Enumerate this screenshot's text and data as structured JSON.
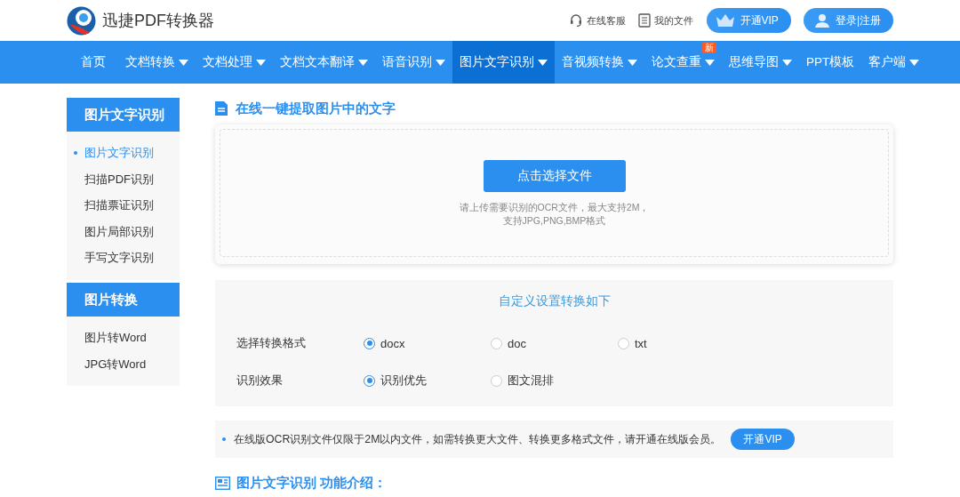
{
  "header": {
    "logo_text": "迅捷PDF转换器",
    "links": [
      {
        "kind": "service",
        "label": "在线客服"
      },
      {
        "kind": "files",
        "label": "我的文件"
      }
    ],
    "vip_button": "开通VIP",
    "login_button": "登录|注册"
  },
  "nav": [
    {
      "label": "首页",
      "dropdown": false,
      "selected": false
    },
    {
      "label": "文档转换",
      "dropdown": true,
      "selected": false
    },
    {
      "label": "文档处理",
      "dropdown": true,
      "selected": false
    },
    {
      "label": "文档文本翻译",
      "dropdown": true,
      "selected": false
    },
    {
      "label": "语音识别",
      "dropdown": true,
      "selected": false
    },
    {
      "label": "图片文字识别",
      "dropdown": true,
      "selected": true
    },
    {
      "label": "音视频转换",
      "dropdown": true,
      "selected": false
    },
    {
      "label": "论文查重",
      "dropdown": true,
      "selected": false,
      "badge": "新"
    },
    {
      "label": "思维导图",
      "dropdown": true,
      "selected": false
    },
    {
      "label": "PPT模板",
      "dropdown": false,
      "selected": false
    },
    {
      "label": "客户端",
      "dropdown": true,
      "selected": false
    }
  ],
  "sidebar": [
    {
      "title": "图片文字识别",
      "items": [
        {
          "label": "图片文字识别",
          "selected": true
        },
        {
          "label": "扫描PDF识别",
          "selected": false
        },
        {
          "label": "扫描票证识别",
          "selected": false
        },
        {
          "label": "图片局部识别",
          "selected": false
        },
        {
          "label": "手写文字识别",
          "selected": false
        }
      ]
    },
    {
      "title": "图片转换",
      "items": [
        {
          "label": "图片转Word",
          "selected": false
        },
        {
          "label": "JPG转Word",
          "selected": false
        }
      ]
    }
  ],
  "main": {
    "title": "在线一键提取图片中的文字",
    "upload": {
      "button": "点击选择文件",
      "hint_lines": [
        "请上传需要识别的OCR文件，最大支持2M，",
        "支持JPG,PNG,BMP格式"
      ]
    },
    "settings": {
      "heading": "自定义设置转换如下",
      "rows": [
        {
          "label": "选择转换格式",
          "options": [
            {
              "label": "docx",
              "selected": true
            },
            {
              "label": "doc",
              "selected": false
            },
            {
              "label": "txt",
              "selected": false
            }
          ]
        },
        {
          "label": "识别效果",
          "options": [
            {
              "label": "识别优先",
              "selected": true
            },
            {
              "label": "图文混排",
              "selected": false
            }
          ]
        }
      ]
    },
    "notice": {
      "text": "在线版OCR识别文件仅限于2M以内文件，如需转换更大文件、转换更多格式文件，请开通在线版会员。",
      "button": "开通VIP"
    },
    "section_title": "图片文字识别 功能介绍："
  }
}
